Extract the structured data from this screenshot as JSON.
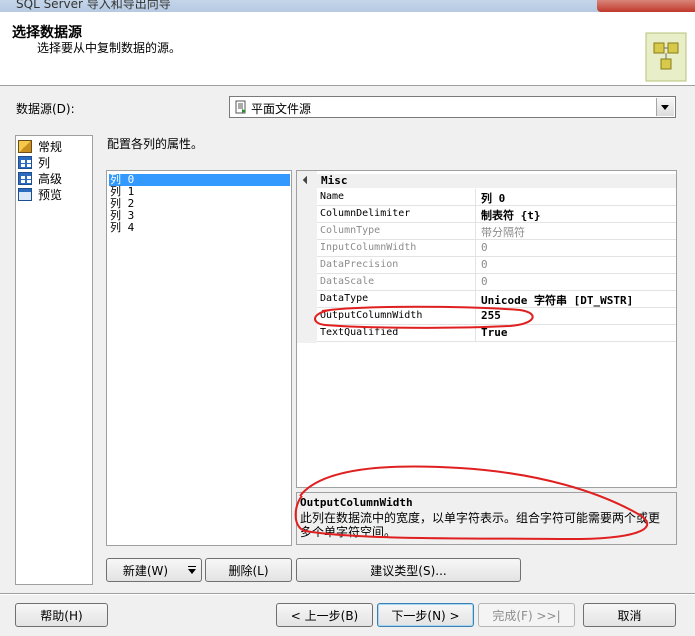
{
  "window": {
    "title": "SQL Server 导入和导出向导"
  },
  "header": {
    "title": "选择数据源",
    "subtitle": "选择要从中复制数据的源。"
  },
  "source": {
    "label": "数据源(D):",
    "value": "平面文件源"
  },
  "nav": {
    "items": [
      {
        "label": "常规",
        "icon": "general-icon"
      },
      {
        "label": "列",
        "icon": "columns-icon"
      },
      {
        "label": "高级",
        "icon": "advanced-icon"
      },
      {
        "label": "预览",
        "icon": "preview-icon"
      }
    ]
  },
  "instruction": "配置各列的属性。",
  "columns": {
    "items": [
      "列 0",
      "列 1",
      "列 2",
      "列 3",
      "列 4"
    ],
    "selected": 0
  },
  "properties": {
    "category": "Misc",
    "rows": [
      {
        "name": "Name",
        "value": "列 0",
        "bold": true
      },
      {
        "name": "ColumnDelimiter",
        "value": "制表符 {t}",
        "bold": true
      },
      {
        "name": "ColumnType",
        "value": "带分隔符",
        "readonly": true
      },
      {
        "name": "InputColumnWidth",
        "value": "0",
        "readonly": true
      },
      {
        "name": "DataPrecision",
        "value": "0",
        "readonly": true
      },
      {
        "name": "DataScale",
        "value": "0",
        "readonly": true
      },
      {
        "name": "DataType",
        "value": "Unicode 字符串 [DT_WSTR]",
        "bold": true
      },
      {
        "name": "OutputColumnWidth",
        "value": "255",
        "bold": true
      },
      {
        "name": "TextQualified",
        "value": "True",
        "bold": true
      }
    ]
  },
  "description": {
    "title": "OutputColumnWidth",
    "text": "此列在数据流中的宽度，以单字符表示。组合字符可能需要两个或更多个单字符空间。"
  },
  "buttons": {
    "new": "新建(W)",
    "delete": "删除(L)",
    "suggest": "建议类型(S)...",
    "help": "帮助(H)",
    "back": "< 上一步(B)",
    "next": "下一步(N) >",
    "finish": "完成(F) >>|",
    "cancel": "取消"
  },
  "colors": {
    "selection": "#3399ff",
    "annotation": "#e02020"
  }
}
